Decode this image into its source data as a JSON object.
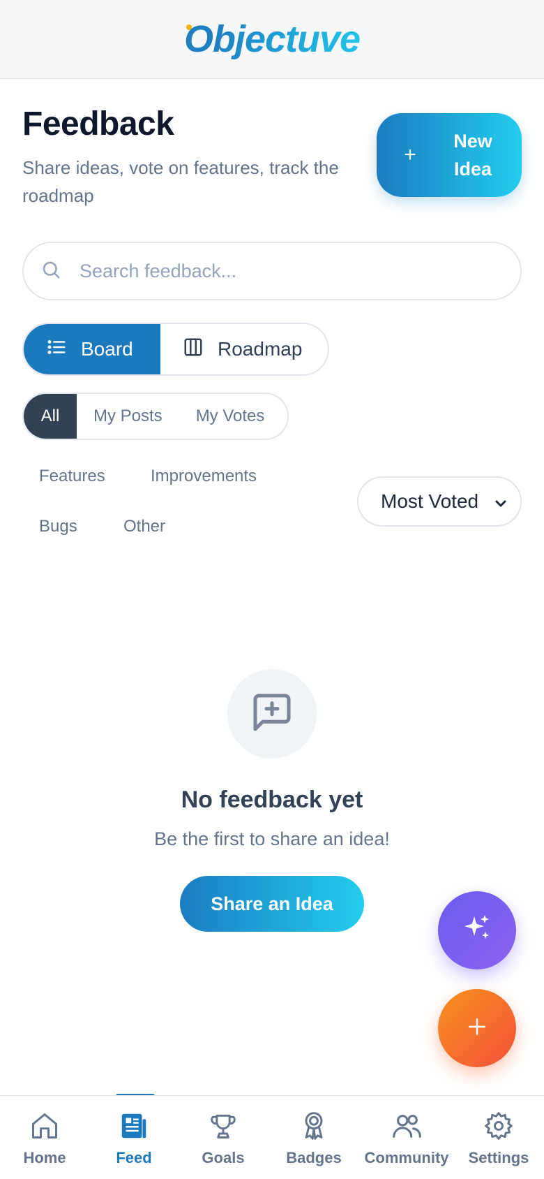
{
  "app": {
    "logo_first": "O",
    "logo_rest": "bjectuve"
  },
  "header": {
    "title": "Feedback",
    "subtitle": "Share ideas, vote on features, track the roadmap",
    "new_idea_label": "New Idea"
  },
  "search": {
    "placeholder": "Search feedback..."
  },
  "view_toggle": {
    "board": "Board",
    "roadmap": "Roadmap",
    "active": "board"
  },
  "scope_filter": {
    "all": "All",
    "my_posts": "My Posts",
    "my_votes": "My Votes",
    "active": "all"
  },
  "categories": {
    "features": "Features",
    "improvements": "Improvements",
    "bugs": "Bugs",
    "other": "Other"
  },
  "sort": {
    "selected": "Most Voted"
  },
  "empty_state": {
    "title": "No feedback yet",
    "subtitle": "Be the first to share an idea!",
    "button": "Share an Idea"
  },
  "fabs": {
    "ai_icon": "sparkles-icon",
    "add_icon": "plus-icon"
  },
  "bottom_nav": {
    "home": "Home",
    "feed": "Feed",
    "goals": "Goals",
    "badges": "Badges",
    "community": "Community",
    "settings": "Settings",
    "active": "feed"
  },
  "colors": {
    "primary": "#1b79bd",
    "primary_gradient_end": "#23cdef",
    "ai_fab": "#7b5ff0",
    "add_fab": "#f5743a",
    "text_dark": "#0f172a",
    "muted": "#64748b"
  }
}
